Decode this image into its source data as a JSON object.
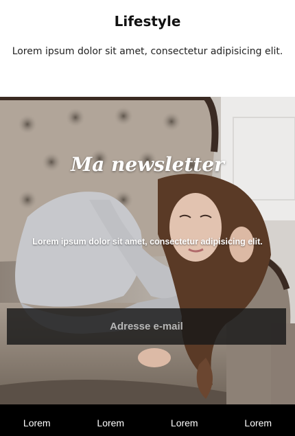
{
  "header": {
    "title": "Lifestyle",
    "subtitle": "Lorem ipsum dolor sit amet, consectetur adipisicing elit."
  },
  "newsletter": {
    "title": "Ma newsletter",
    "text": "Lorem ipsum dolor sit amet, consectetur adipisicing elit.",
    "email_placeholder": "Adresse e-mail"
  },
  "footer": {
    "links": [
      "Lorem",
      "Lorem",
      "Lorem",
      "Lorem"
    ]
  }
}
